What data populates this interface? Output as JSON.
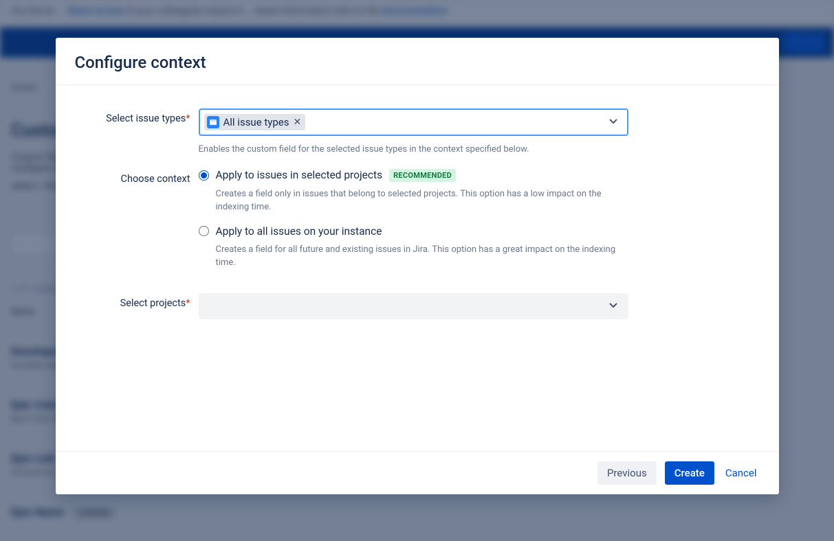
{
  "modal": {
    "title": "Configure context",
    "issue_types": {
      "label": "Select issue types",
      "tag_label": "All issue types",
      "help": "Enables the custom field for the selected issue types in the context specified below."
    },
    "context": {
      "label": "Choose context",
      "option1_label": "Apply to issues in selected projects",
      "option1_badge": "RECOMMENDED",
      "option1_desc": "Creates a field only in issues that belong to selected projects. This option has a low impact on the indexing time.",
      "option2_label": "Apply to all issues on your instance",
      "option2_desc": "Creates a field for all future and existing issues in Jira. This option has a great impact on the indexing time."
    },
    "projects": {
      "label": "Select projects"
    },
    "footer": {
      "previous": "Previous",
      "create": "Create",
      "cancel": "Cancel"
    }
  }
}
